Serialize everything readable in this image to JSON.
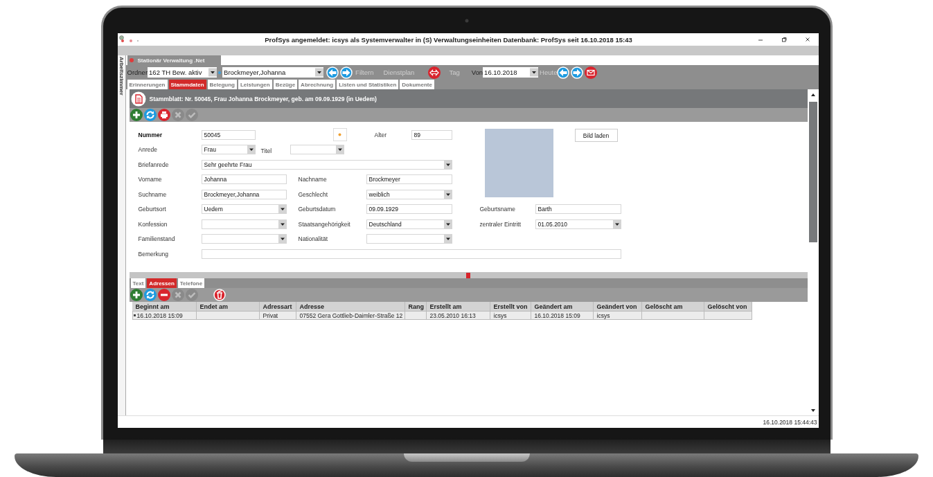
{
  "window": {
    "title": "ProfSys angemeldet: icsys als Systemverwalter in (S) Verwaltungseinheiten Datenbank: ProfSys seit 16.10.2018 15:43"
  },
  "side_panel": {
    "label": "Arbeitszimmer"
  },
  "document_tab": {
    "label": "Stationär Verwaltung .Net"
  },
  "toolbar": {
    "ordner": {
      "label": "Ordner",
      "value": "162 TH Bew. aktiv",
      "disabled": false
    },
    "resident": {
      "value": "Brockmeyer,Johanna"
    },
    "filter": {
      "label": "Filtern",
      "disabled": true
    },
    "dienstplan": {
      "label": "Dienstplan",
      "disabled": true
    },
    "tag": {
      "label": "Tag",
      "disabled": true
    },
    "von": {
      "label": "Von",
      "value": "16.10.2018",
      "disabled": false
    },
    "heute": {
      "label": "Heute",
      "disabled": true
    }
  },
  "tabs": [
    {
      "label": "Erinnerungen",
      "selected": false
    },
    {
      "label": "Stammdaten",
      "selected": true
    },
    {
      "label": "Belegung",
      "selected": false
    },
    {
      "label": "Leistungen",
      "selected": false
    },
    {
      "label": "Bezüge",
      "selected": false
    },
    {
      "label": "Abrechnung",
      "selected": false
    },
    {
      "label": "Listen und Statistiken",
      "selected": false
    },
    {
      "label": "Dokumente",
      "selected": false
    }
  ],
  "record_header": "Stammblatt: Nr. 50045, Frau Johanna Brockmeyer,  geb. am 09.09.1929 (in Uedem)",
  "form": {
    "fields": {
      "nummer": {
        "label": "Nummer",
        "value": "50045",
        "kind": "text"
      },
      "alter": {
        "label": "Alter",
        "value": "89",
        "kind": "text"
      },
      "anrede": {
        "label": "Anrede",
        "value": "Frau",
        "kind": "combo"
      },
      "titel": {
        "label": "Titel",
        "kind": "combo"
      },
      "briefanrede": {
        "label": "Briefanrede",
        "value": "Sehr geehrte Frau",
        "kind": "combo"
      },
      "vorname": {
        "label": "Vorname",
        "value": "Johanna",
        "kind": "text"
      },
      "nachname": {
        "label": "Nachname",
        "value": "Brockmeyer",
        "kind": "text"
      },
      "suchname": {
        "label": "Suchname",
        "value": "Brockmeyer,Johanna",
        "kind": "text"
      },
      "geschlecht": {
        "label": "Geschlecht",
        "value": "weiblich",
        "kind": "combo"
      },
      "geburtsort": {
        "label": "Geburtsort",
        "value": "Uedem",
        "kind": "combo"
      },
      "geburtsdatum": {
        "label": "Geburtsdatum",
        "value": "09.09.1929",
        "kind": "text"
      },
      "geburtsname": {
        "label": "Geburtsname",
        "value": "Barth",
        "kind": "text"
      },
      "konfession": {
        "label": "Konfession",
        "kind": "combo"
      },
      "staatsangehoerigkeit": {
        "label": "Staatsangehörigkeit",
        "value": "Deutschland",
        "kind": "combo"
      },
      "zentraler_eintritt": {
        "label": "zentraler Eintritt",
        "value": "01.05.2010",
        "kind": "combo"
      },
      "familienstand": {
        "label": "Familienstand",
        "kind": "combo"
      },
      "nationalitaet": {
        "label": "Nationalität",
        "kind": "combo"
      },
      "bemerkung": {
        "label": "Bemerkung",
        "kind": "text"
      }
    },
    "load_image_button": "Bild laden"
  },
  "address_tabs": [
    {
      "label": "Text",
      "selected": false
    },
    {
      "label": "Adressen",
      "selected": true
    },
    {
      "label": "Telefone",
      "selected": false
    }
  ],
  "table": {
    "columns": [
      "Beginnt am",
      "Endet am",
      "Adressart",
      "Adresse",
      "Rang",
      "Erstellt am",
      "Erstellt von",
      "Geändert am",
      "Geändert von",
      "Gelöscht am",
      "Gelöscht von"
    ],
    "rows": [
      {
        "cells": [
          "16.10.2018 15:09",
          null,
          "Privat",
          "07552 Gera Gottlieb-Daimler-Straße 12",
          null,
          "23.05.2010 16:13",
          "icsys",
          "16.10.2018 15:09",
          "icsys",
          null,
          null
        ]
      }
    ]
  },
  "status_bar": {
    "time": "16.10.2018 15:44:43"
  }
}
